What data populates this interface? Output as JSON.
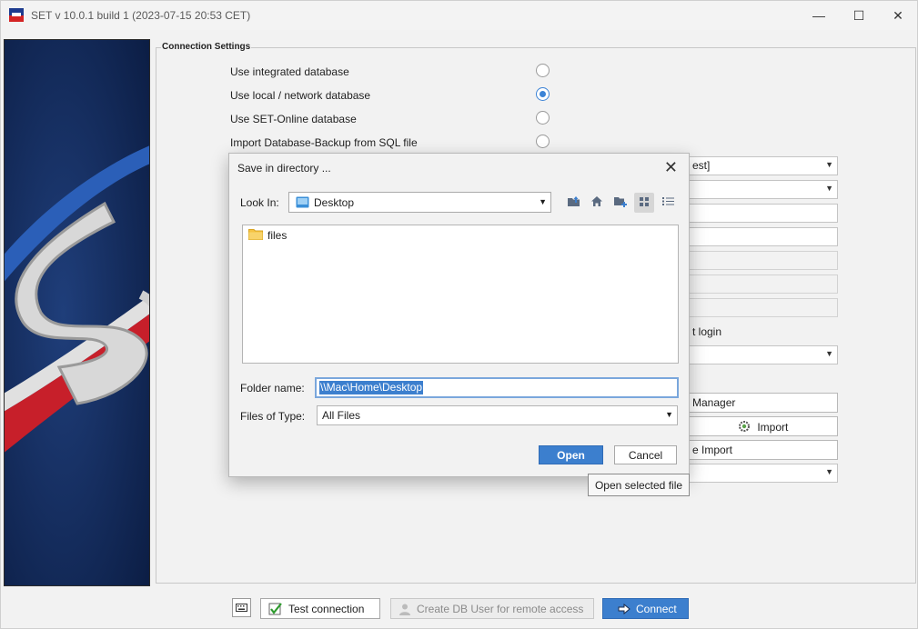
{
  "window": {
    "title": "SET v 10.0.1 build 1 (2023-07-15 20:53 CET)",
    "min_glyph": "—",
    "max_glyph": "☐",
    "close_glyph": "✕"
  },
  "connection": {
    "group_title": "Connection Settings",
    "options": [
      {
        "label": "Use integrated database",
        "checked": false
      },
      {
        "label": "Use local / network database",
        "checked": true
      },
      {
        "label": "Use SET-Online database",
        "checked": false
      },
      {
        "label": "Import Database-Backup from SQL file",
        "checked": false
      }
    ],
    "partial": {
      "combo1": "est]",
      "login_text": "t login",
      "manager_btn": "Manager",
      "import_btn": "Import",
      "import2_btn": "e Import"
    }
  },
  "bottom": {
    "test_connection": "Test connection",
    "create_db_user": "Create DB User for remote access",
    "connect": "Connect"
  },
  "dialog": {
    "title": "Save in directory ...",
    "look_in_label": "Look In:",
    "look_in_value": "Desktop",
    "files": [
      {
        "name": "files",
        "icon": "folder-icon"
      }
    ],
    "folder_name_label": "Folder name:",
    "folder_name_value": "\\\\Mac\\Home\\Desktop",
    "files_of_type_label": "Files of Type:",
    "files_of_type_value": "All Files",
    "open_label": "Open",
    "cancel_label": "Cancel",
    "close_glyph": "✕"
  },
  "tooltip": {
    "text": "Open selected file"
  },
  "colors": {
    "accent": "#3c7fce",
    "folder": "#f5c342"
  }
}
